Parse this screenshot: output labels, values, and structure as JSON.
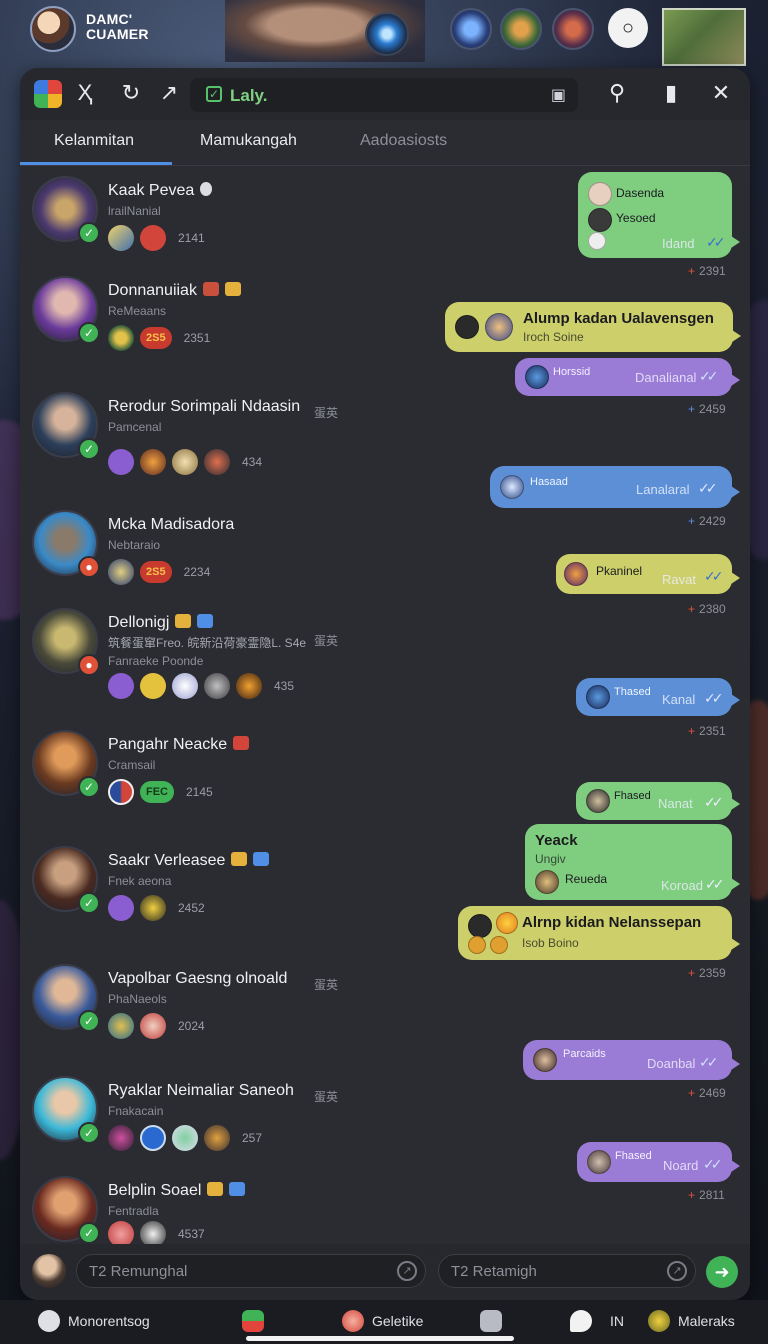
{
  "top": {
    "brand_line1": "DAMC'",
    "brand_line2": "CUAMER",
    "chat_icon": "chat-bubble-icon"
  },
  "toolbar": {
    "url": "Laly.",
    "icons": [
      "app-logo-icon",
      "text-cursor-icon",
      "refresh-icon",
      "share-icon",
      "lock-icon",
      "search-icon",
      "bookmark-icon",
      "close-icon"
    ]
  },
  "tabs": [
    {
      "label": "Kelanmitan",
      "active": true
    },
    {
      "label": "Mamukangah",
      "active": false
    },
    {
      "label": "Aadoasiosts",
      "active": false
    }
  ],
  "contacts": [
    {
      "name": "Kaak Pevea",
      "sub": "lrailNanial",
      "badge": "",
      "count": "2141",
      "tag": ""
    },
    {
      "name": "Donnanuiiak",
      "sub": "ReMeaans",
      "badge": "2S5",
      "count": "2351",
      "tag": ""
    },
    {
      "name": "Rerodur Sorimpali Ndaasin",
      "sub": "Pamcenal",
      "badge": "",
      "count": "434",
      "tag": "蛋英"
    },
    {
      "name": "Mcka Madisadora",
      "sub": "Nebtaraio",
      "badge": "2S5",
      "count": "2234",
      "tag": ""
    },
    {
      "name": "Dellonigj",
      "sub": "Fanraeke Poonde",
      "line2": "筑餐蛋窜Freo. 皖新沿荷豪霊隐L. S4e",
      "badge": "",
      "count": "435",
      "tag": "蛋英"
    },
    {
      "name": "Pangahr Neacke",
      "sub": "Cramsail",
      "badge": "FEC",
      "count": "2145",
      "tag": ""
    },
    {
      "name": "Saakr Verleasee",
      "sub": "Fnek aeona",
      "badge": "",
      "count": "2452",
      "tag": ""
    },
    {
      "name": "Vapolbar Gaesng olnoald",
      "sub": "PhaNaeols",
      "badge": "",
      "count": "2024",
      "tag": "蛋英"
    },
    {
      "name": "Ryaklar Neimaliar Saneoh",
      "sub": "Fnakacain",
      "badge": "",
      "count": "257",
      "tag": "蛋英"
    },
    {
      "name": "Belplin Soael",
      "sub": "Fentradla",
      "badge": "",
      "count": "4537",
      "tag": ""
    }
  ],
  "messages": [
    {
      "line1": "Dasenda",
      "line2": "Yesoed",
      "right": "Idand",
      "meta": "2391"
    },
    {
      "title": "Alump kadan Ualavensgen",
      "sub": "Iroch Soine"
    },
    {
      "left": "Horssid",
      "right": "Danalianal",
      "meta": "2459"
    },
    {
      "left": "Hasaad",
      "right": "Lanalaral",
      "meta": "2429"
    },
    {
      "left": "Pkaninel",
      "right": "Ravat",
      "meta": "2380"
    },
    {
      "left": "Thased",
      "right": "Kanal",
      "meta": "2351"
    },
    {
      "left": "Fhased",
      "right": "Nanat"
    },
    {
      "title": "Yeack",
      "sub": "Ungiv",
      "left": "Reueda",
      "right": "Koroad"
    },
    {
      "title": "Alrnp kidan Nelanssepan",
      "sub": "Isob Boino",
      "meta": "2359"
    },
    {
      "left": "Parcaids",
      "right": "Doanbal",
      "meta": "2469"
    },
    {
      "left": "Fhased",
      "right": "Noard",
      "meta": "2811"
    }
  ],
  "composer": {
    "placeholder_left": "T2 Remunghal",
    "placeholder_right": "T2 Retamigh"
  },
  "taskbar": [
    {
      "label": "Monorentsog",
      "icon": "camera-icon"
    },
    {
      "label": "",
      "icon": "app-store-icon"
    },
    {
      "label": "Geletike",
      "icon": "browser-icon"
    },
    {
      "label": "",
      "icon": "notes-icon"
    },
    {
      "label": "IN",
      "icon": "drop-icon"
    },
    {
      "label": "Maleraks",
      "icon": "game-icon"
    }
  ],
  "colors": {
    "accent": "#4f8fe6",
    "green": "#7fce7f",
    "yellow": "#cdd06a",
    "purple": "#9a7bd6",
    "blue": "#5d8fd6",
    "online": "#3fb356"
  }
}
